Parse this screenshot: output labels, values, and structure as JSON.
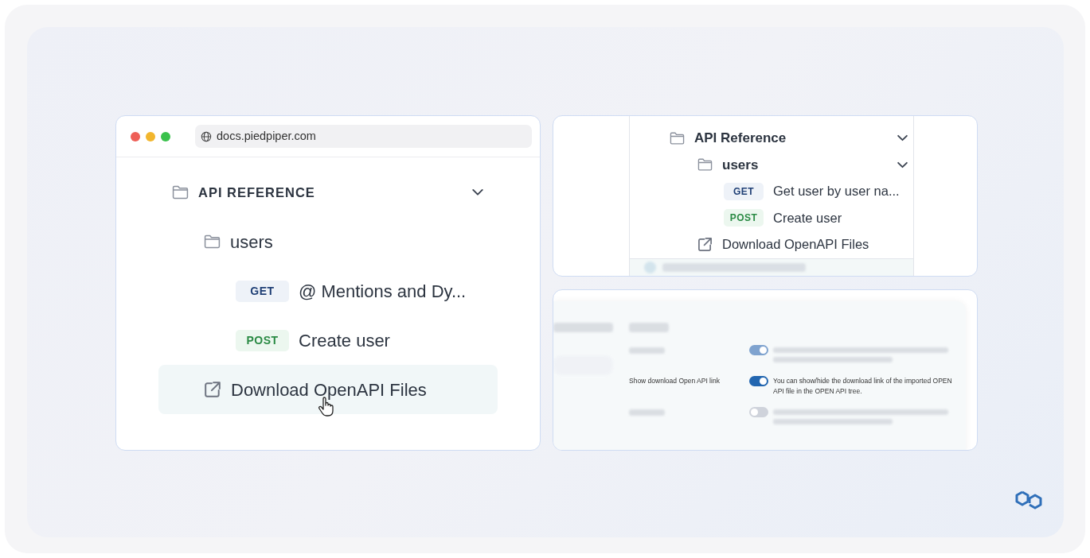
{
  "left_window": {
    "url": "docs.piedpiper.com",
    "tree": [
      {
        "kind": "section",
        "label": "API REFERENCE",
        "show_chevron": true,
        "children": [
          {
            "kind": "folder",
            "label": "users",
            "show_chevron": false,
            "children": [
              {
                "kind": "get",
                "method": "GET",
                "label": "@ Mentions and Dy..."
              },
              {
                "kind": "post",
                "method": "POST",
                "label": "Create user"
              }
            ]
          },
          {
            "kind": "download",
            "label": "Download OpenAPI Files",
            "highlighted": true
          }
        ]
      }
    ]
  },
  "sidebar_crop": {
    "tree": [
      {
        "kind": "section",
        "label": "API Reference",
        "show_chevron": true,
        "children": [
          {
            "kind": "folder",
            "label": "users",
            "show_chevron": true,
            "children": [
              {
                "kind": "get",
                "method": "GET",
                "label": "Get user by user na..."
              },
              {
                "kind": "post",
                "method": "POST",
                "label": "Create user"
              }
            ]
          },
          {
            "kind": "download",
            "label": "Download OpenAPI Files",
            "highlighted": false
          }
        ]
      }
    ]
  },
  "settings": {
    "rows": [
      {
        "kind": "blurred",
        "on": true
      },
      {
        "kind": "sharp",
        "label": "Show download Open API link",
        "on": true,
        "description": "You can show/hide the download link of the imported OPEN API file in the OPEN API tree."
      },
      {
        "kind": "blurred",
        "on": false
      }
    ]
  }
}
